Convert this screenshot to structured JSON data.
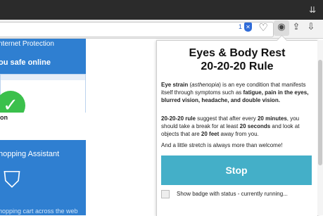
{
  "toolbar": {
    "badge_count": "1",
    "shield_glyph": "✕",
    "heart_glyph": "♡",
    "eye_glyph": "◉",
    "share_glyph": "⇪",
    "download_glyph": "⇩",
    "menu_glyph": "⇊"
  },
  "page": {
    "card1_title": "nternet Protection",
    "card1_subtitle": "ou safe online",
    "card1_caption": "on",
    "card2_title": "hopping Assistant",
    "card2_footer": "hopping cart across the web",
    "check_glyph": "✓",
    "bag_glyph": "⛉"
  },
  "popup": {
    "title_line1": "Eyes & Body Rest",
    "title_line2": "20-20-20 Rule",
    "para1": {
      "a_bold": "Eye strain",
      "b": " (",
      "c_italic": "asthenopia",
      "d": ") is an eye condition that manifests itself through symptoms such as ",
      "e_bold": "fatigue, pain in the eyes, blurred vision, headache, and double vision."
    },
    "para2": {
      "a_bold": "20-20-20 rule",
      "b": " suggest that after every ",
      "c_bold": "20 minutes",
      "d": ", you should take a break for at least ",
      "e_bold": "20 seconds",
      "f": " and look at objects that are ",
      "g_bold": "20 feet",
      "h": " away from you."
    },
    "para3": "And a little stretch is always more than welcome!",
    "stop_label": "Stop",
    "checkbox_label": "Show badge with status - currently running...",
    "checkbox_checked": false
  },
  "colors": {
    "accent": "#44afc8",
    "page_blue": "#2f7fd1",
    "check_green": "#3bc04c"
  }
}
